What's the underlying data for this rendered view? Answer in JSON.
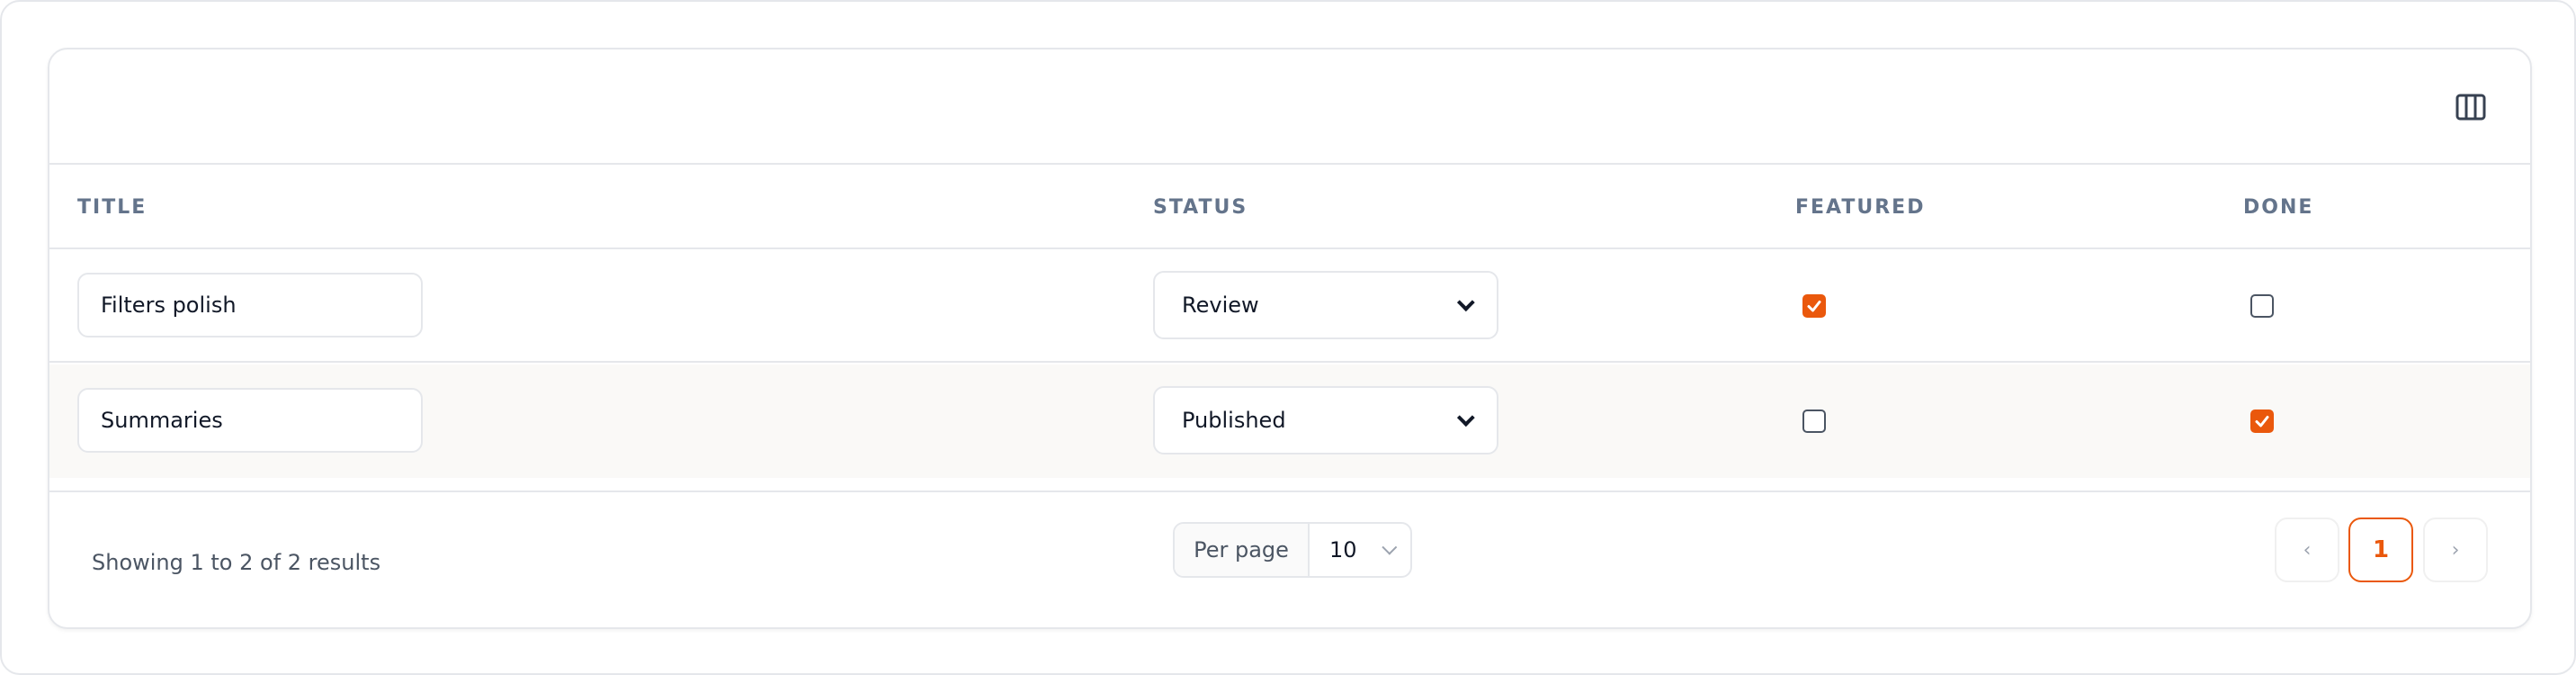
{
  "table": {
    "columns": [
      "TITLE",
      "STATUS",
      "FEATURED",
      "DONE"
    ],
    "rows": [
      {
        "title": "Filters polish",
        "status": "Review",
        "featured": true,
        "done": false
      },
      {
        "title": "Summaries",
        "status": "Published",
        "featured": false,
        "done": true
      }
    ]
  },
  "toolbar": {
    "columns_icon": "columns-icon"
  },
  "footer": {
    "showing_text": "Showing 1 to 2 of 2 results",
    "per_page_label": "Per page",
    "per_page_value": "10",
    "pagination": {
      "prev": "‹",
      "current_page": "1",
      "next": "›"
    }
  },
  "colors": {
    "accent": "#ea580c",
    "border": "#e5e7eb",
    "header_text": "#64748b",
    "alt_row_bg": "#faf9f7"
  }
}
